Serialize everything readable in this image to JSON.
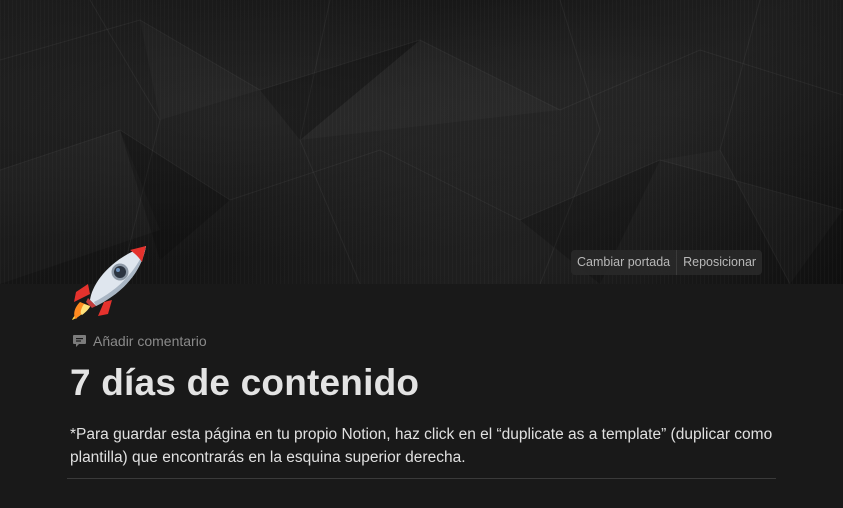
{
  "cover": {
    "change_cover_label": "Cambiar portada",
    "reposition_label": "Reposicionar"
  },
  "page": {
    "icon": "rocket-icon",
    "add_comment_label": "Añadir comentario",
    "title": "7 días de contenido",
    "description": "*Para guardar esta página en tu propio Notion, haz click en el “duplicate as a template” (duplicar como plantilla) que encontrarás en la esquina superior derecha."
  }
}
